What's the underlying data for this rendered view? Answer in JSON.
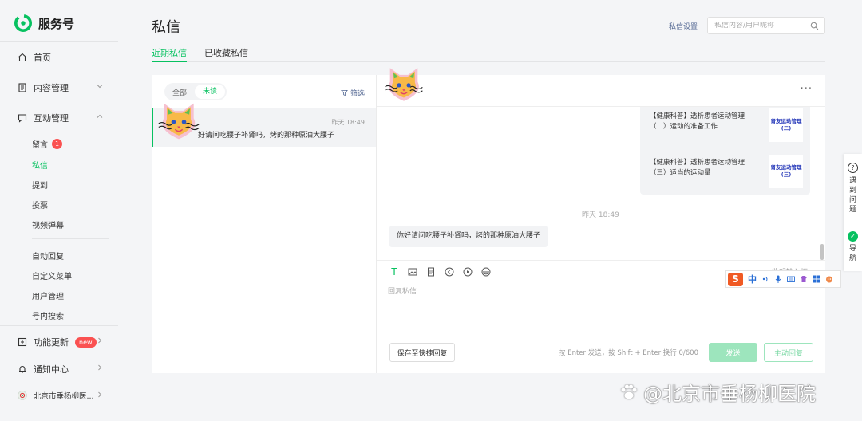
{
  "brand": {
    "name": "服务号",
    "logo_color": "#07c160"
  },
  "sidebar": {
    "items": [
      {
        "label": "首页",
        "icon": "home-icon"
      },
      {
        "label": "内容管理",
        "icon": "document-icon"
      },
      {
        "label": "互动管理",
        "icon": "chat-icon"
      }
    ],
    "sub_items": [
      {
        "label": "留言",
        "badge": "1"
      },
      {
        "label": "私信",
        "active": true
      },
      {
        "label": "提到"
      },
      {
        "label": "投票"
      },
      {
        "label": "视频弹幕"
      },
      {
        "label": "自动回复"
      },
      {
        "label": "自定义菜单"
      },
      {
        "label": "用户管理"
      },
      {
        "label": "号内搜索"
      }
    ],
    "bottom_items": [
      {
        "label": "功能更新",
        "badge": "new",
        "icon": "update-icon"
      },
      {
        "label": "通知中心",
        "icon": "bell-icon"
      },
      {
        "label": "北京市垂杨柳医...",
        "icon": "account-avatar"
      }
    ]
  },
  "header": {
    "title": "私信",
    "settings_label": "私信设置",
    "search_placeholder": "私信内容/用户昵称"
  },
  "tabs": [
    {
      "label": "近期私信",
      "active": true
    },
    {
      "label": "已收藏私信",
      "active": false
    }
  ],
  "list": {
    "filters": [
      {
        "label": "全部"
      },
      {
        "label": "未读",
        "active": true
      }
    ],
    "filter_button": "筛选",
    "conversations": [
      {
        "time": "昨天 18:49",
        "preview": "好请问吃腰子补肾吗，烤的那种原油大腰子"
      }
    ]
  },
  "chat": {
    "more_label": "···",
    "articles": [
      {
        "title": "【健康科普】透析患者运动管理（二）运动的准备工作",
        "thumb": "肾友运动管理(二)"
      },
      {
        "title": "【健康科普】透析患者运动管理（三）适当的运动量",
        "thumb": "肾友运动管理(三)"
      }
    ],
    "time_divider": "昨天 18:49",
    "message": "你好请问吃腰子补肾吗，烤的那种原油大腰子",
    "collapse_label": "收起输入框",
    "reply_placeholder": "回复私信",
    "quick_reply_label": "保存至快捷回复",
    "hint": "按 Enter 发送，按 Shift + Enter 换行  0/600",
    "send_label": "发送",
    "active_reply_label": "主动回复"
  },
  "ime": {
    "logo": "S",
    "mode": "中"
  },
  "float_help": {
    "help_label": "遇到问题",
    "guide_label": "导航"
  },
  "watermark": "@北京市垂杨柳医院",
  "colors": {
    "accent": "#07c160",
    "link": "#576b95",
    "badge": "#fa5151"
  }
}
